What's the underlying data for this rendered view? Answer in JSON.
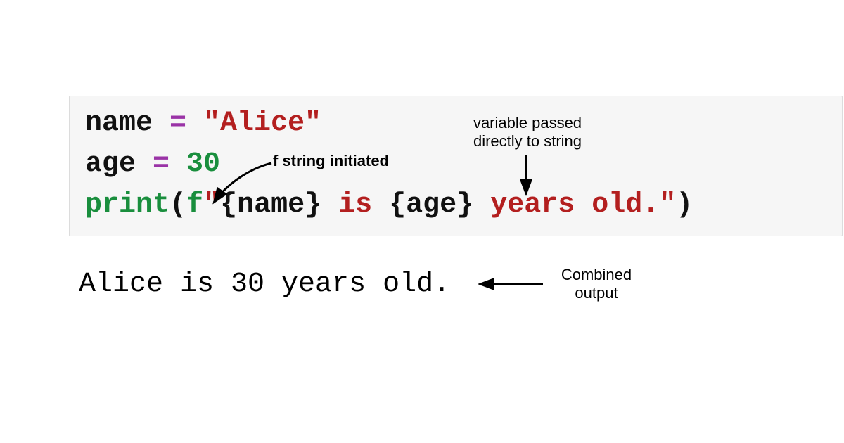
{
  "code": {
    "line1": {
      "var": "name",
      "eq": " = ",
      "str": "\"Alice\""
    },
    "line2": {
      "var": "age",
      "eq": " = ",
      "num": "30"
    },
    "line3": {
      "func": "print",
      "openParen": "(",
      "prefix": "f",
      "strOpen": "\"",
      "lbrace1": "{",
      "varName": "name",
      "rbrace1": "}",
      "mid": " is ",
      "lbrace2": "{",
      "varAge": "age",
      "rbrace2": "}",
      "tail": " years old.",
      "strClose": "\"",
      "closeParen": ")"
    }
  },
  "output": "Alice is 30 years old.",
  "annotations": {
    "fstring": "f string initiated",
    "varpassed_l1": "variable passed",
    "varpassed_l2": "directly to string",
    "combined_l1": "Combined",
    "combined_l2": "output"
  }
}
